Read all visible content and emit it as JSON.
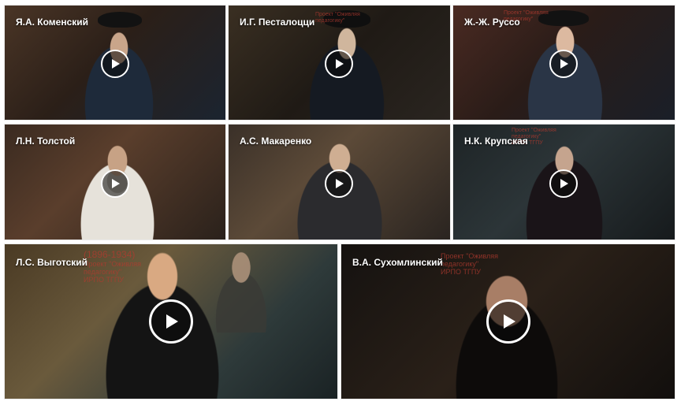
{
  "videos": [
    {
      "title": "Я.А. Коменский"
    },
    {
      "title": "И.Г. Песталоцци"
    },
    {
      "title": "Ж.-Ж. Руссо"
    },
    {
      "title": "Л.Н. Толстой"
    },
    {
      "title": "А.С. Макаренко"
    },
    {
      "title": "Н.К. Крупская"
    },
    {
      "title": "Л.С. Выготский"
    },
    {
      "title": "В.А. Сухомлинский"
    }
  ],
  "overlays": {
    "pestalozzi": [
      "Проект \"Оживляя",
      "педагогику\""
    ],
    "rousseau": [
      "Проект \"Оживляя",
      "педагогику\""
    ],
    "krupskaya": [
      "Проект \"Оживляя",
      "педагогику\"",
      "ИРПО ТГПУ"
    ],
    "vygotsky": [
      "(1896-1934)",
      "Проект \"Оживляя",
      "педагогику\"",
      "ИРПО ТГПУ"
    ],
    "sukhomlinsky": [
      "Проект \"Оживляя",
      "педагогику\"",
      "ИРПО ТГПУ"
    ]
  },
  "icons": {
    "play": "play-icon"
  },
  "colors": {
    "overlay_text": "#b23a2f",
    "title_text": "#ffffff"
  }
}
